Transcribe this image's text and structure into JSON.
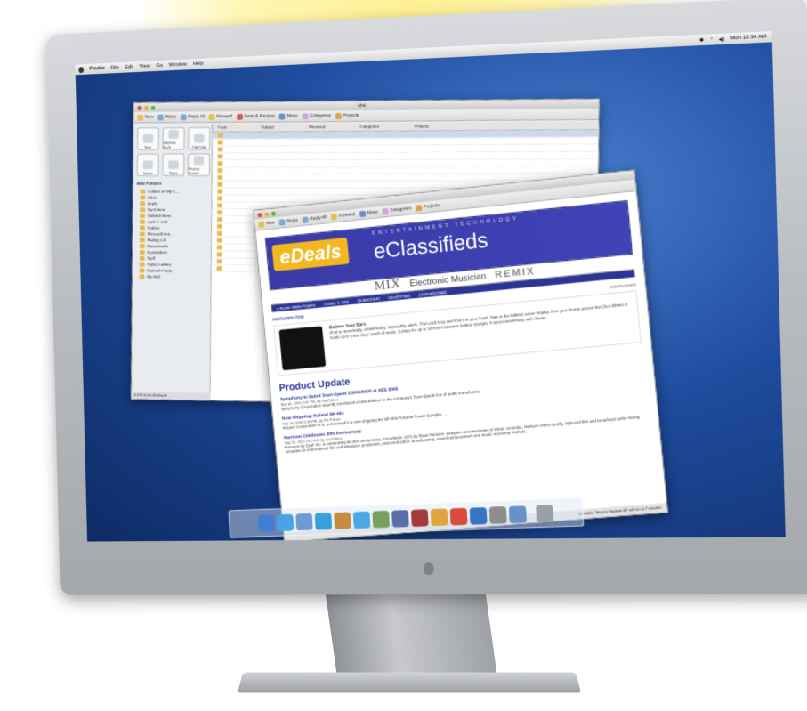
{
  "menubar": {
    "app": "Finder",
    "items": [
      "File",
      "Edit",
      "View",
      "Go",
      "Window",
      "Help"
    ],
    "clock": "Mon 10:34 AM"
  },
  "mail_window": {
    "title": "Mail",
    "toolbar": [
      "New",
      "Reply",
      "Reply All",
      "Forward",
      "Send & Receive",
      "Move",
      "Categories",
      "Projects"
    ],
    "side_buttons": [
      "New",
      "Address Book",
      "Calendar",
      "Notes",
      "Tasks",
      "Project Center"
    ],
    "folders_header": "Mail Folders",
    "folders": [
      "Folders on My C...",
      "Inbox",
      "Drafts",
      "Sent Items",
      "Deleted Items",
      "Junk E-mail",
      "Outbox",
      "Microsoft Ent...",
      "Mailing List",
      "Macromedia",
      "Newsletters",
      "Stuff",
      "Public Folders",
      "Network Folder",
      "My Mail"
    ],
    "list_headers": [
      "From",
      "Subject",
      "Received",
      "Categories",
      "Projects"
    ],
    "statusbar": "2,073 items displayed"
  },
  "news_window": {
    "toolbar": [
      "New",
      "Reply",
      "Reply All",
      "Forward",
      "Move",
      "Categories",
      "Projects"
    ],
    "banner": {
      "logo": "eDeals",
      "kicker": "ENTERTAINMENT TECHNOLOGY",
      "headline": "eClassifieds",
      "brands": [
        "MIX",
        "Electronic Musician",
        "REMIX"
      ],
      "nav": [
        "A Penton Media Property",
        "October 3, 2005",
        "[SUBSCRIBE]",
        "[ADVERTISE]",
        "[UNSUBSCRIBE]"
      ]
    },
    "featured_label": "FEATURED ITEM",
    "ad_label": "advertisement",
    "featured": {
      "title": "Believe Your Ears",
      "body": "iPod is remarkably, unbelievably, impossibly, sleek. Then pick it up and hold it in your hand. Take in the brilliant colour display. Run your thumb around the Click Wheel. It holds up to three days' worth of music. It plays for up to 14 hours between battery charges. It syncs seamlessly with iTunes."
    },
    "section_heading": "Product Update",
    "stories": [
      {
        "title": "Symphony to Debut Scan-Speak D3004/6600 at AES 2005",
        "meta": "Sep 30, 2005 3:00 PM, By the Editors",
        "body": "Symphony Corporation recently introduced a new addition to the company's Scan-Speak line of audio transducers. ..."
      },
      {
        "title": "Now Shipping: Roland SP-404",
        "meta": "Sep 30, 2005 3:00 PM, By the Editors",
        "body": "Roland Corporation U.S. announced it is now shipping the SP-404 Portable Power Sampler. ..."
      },
      {
        "title": "Harrison Celebrates 30th Anniversary",
        "meta": "Sep 30, 2005 3:00 PM, By the Editors",
        "body": "Harrison by GLW Inc. is celebrating its 30th anniversary. Founded in 1975 by Dave Harrison, designer and developer of 'inline' consoles, Harrison offers quality, high-end film and broadcast audio mixing consoles for international film and television production, post-production, broadcasting, sound reinforcement and music recording markets. ..."
      }
    ],
    "statusbar": "Schedule \"Send & Receive All\" will run in 7 minutes"
  },
  "dock": {
    "icons": [
      "finder-icon",
      "safari-icon",
      "mail-icon",
      "ichat-icon",
      "address-book-icon",
      "itunes-icon",
      "iphoto-icon",
      "imovie-icon",
      "idvd-icon",
      "garageband-icon",
      "ical-icon",
      "quicktime-icon",
      "system-preferences-icon",
      "applications-icon",
      "trash-icon"
    ],
    "colors": [
      "#3f7fd6",
      "#4aa3e6",
      "#6e9bd3",
      "#3aa0d8",
      "#c88a3c",
      "#4aa8e2",
      "#7aa15b",
      "#5a6fa8",
      "#a33b3b",
      "#e1a43b",
      "#d94b3b",
      "#3a73c2",
      "#8c8c8c",
      "#6a90c8",
      "#9aa0a8"
    ]
  },
  "colors": {
    "desktop": "#1f4c9e",
    "banner_blue": "#3f43b5",
    "edeals_yellow": "#f3b81f"
  }
}
